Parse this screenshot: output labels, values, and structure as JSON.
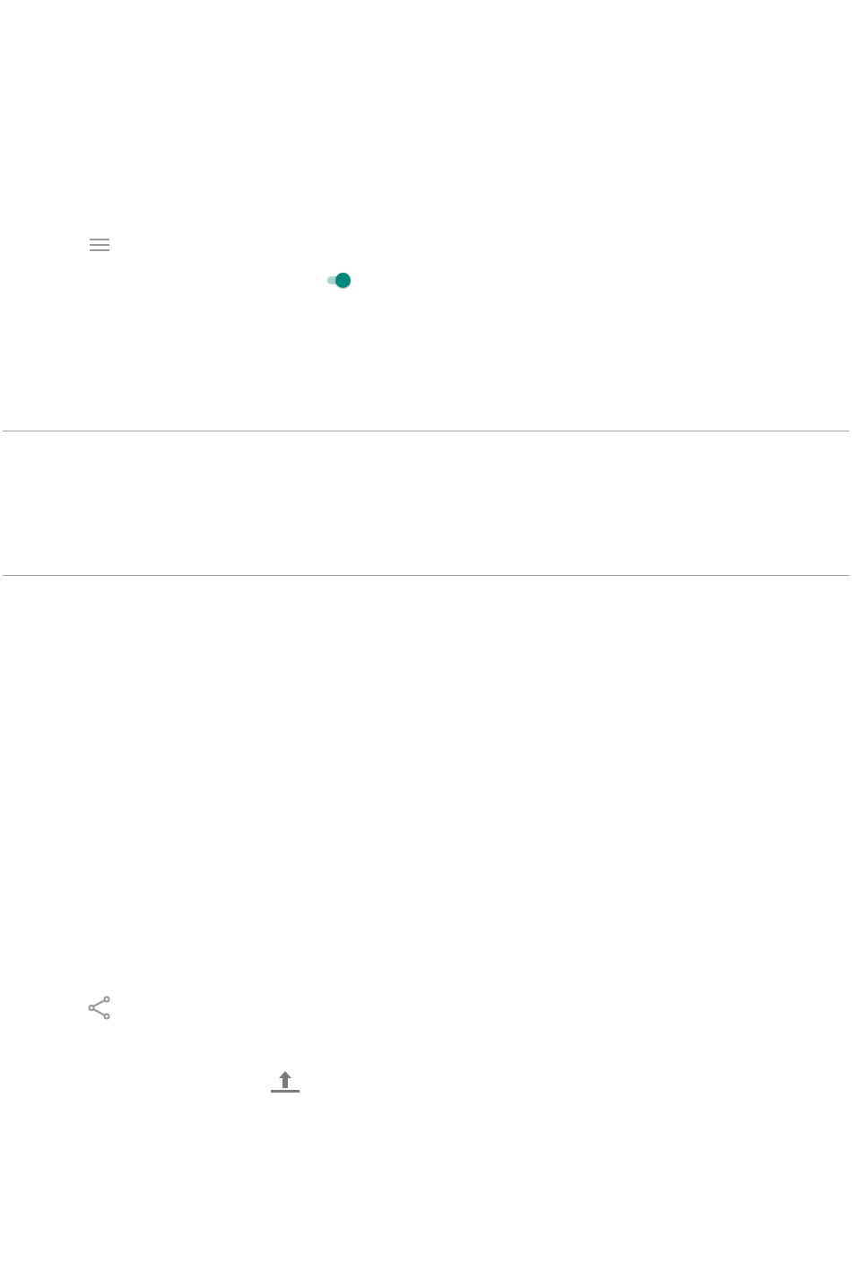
{
  "toggle": {
    "on": true
  }
}
